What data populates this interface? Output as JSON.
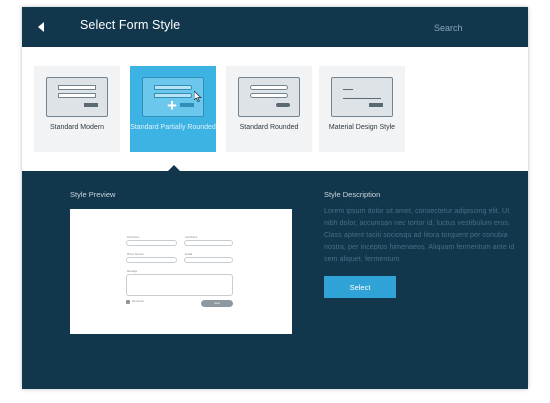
{
  "header": {
    "title": "Select Form Style",
    "search_placeholder": "Search",
    "back_icon": "back-arrow-icon"
  },
  "styles": [
    {
      "label": "Standard Modern",
      "selected": false
    },
    {
      "label": "Standard Partially Rounded",
      "selected": true
    },
    {
      "label": "Standard Rounded",
      "selected": false
    },
    {
      "label": "Material Design Style",
      "selected": false
    }
  ],
  "preview": {
    "heading": "Style Preview",
    "form": {
      "first_name": "First Name",
      "last_name": "Last Name",
      "phone": "Phone Number",
      "email": "E-Mail",
      "message": "Message",
      "checkbox_label": "Remember",
      "send_button": "Send"
    }
  },
  "description": {
    "heading": "Style Description",
    "text": "Lorem ipsum dolor sit amet, consectetur adipiscing elit. Ut nibh dolor, accumsan nec tortor id, luctus vestibulum eros. Class aptent taciti sociosqu ad litora torquent per conubia nostra, per inceptos himenaeos. Aliquam fermentum ante id sem aliquet, fermentum",
    "select_label": "Select"
  },
  "colors": {
    "header_bg": "#12364c",
    "selected_card": "#3cb3e3",
    "select_button": "#2fa2d6"
  }
}
